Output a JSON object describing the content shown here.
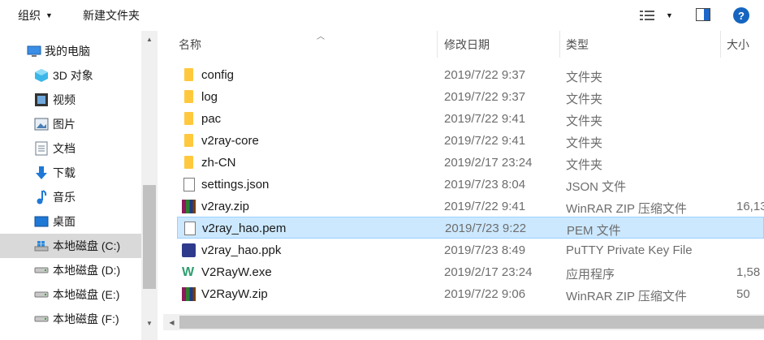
{
  "toolbar": {
    "organize_label": "组织",
    "new_folder_label": "新建文件夹",
    "help_label": "?"
  },
  "nav": {
    "items": [
      {
        "label": "我的电脑",
        "icon": "computer-icon"
      },
      {
        "label": "3D 对象",
        "icon": "3d-objects-icon"
      },
      {
        "label": "视频",
        "icon": "video-icon"
      },
      {
        "label": "图片",
        "icon": "pictures-icon"
      },
      {
        "label": "文档",
        "icon": "documents-icon"
      },
      {
        "label": "下载",
        "icon": "download-icon"
      },
      {
        "label": "音乐",
        "icon": "music-icon"
      },
      {
        "label": "桌面",
        "icon": "desktop-icon"
      },
      {
        "label": "本地磁盘 (C:)",
        "icon": "windows-drive-icon",
        "selected": true
      },
      {
        "label": "本地磁盘 (D:)",
        "icon": "drive-icon"
      },
      {
        "label": "本地磁盘 (E:)",
        "icon": "drive-icon"
      },
      {
        "label": "本地磁盘 (F:)",
        "icon": "drive-icon"
      }
    ]
  },
  "columns": {
    "name": "名称",
    "date": "修改日期",
    "type": "类型",
    "size": "大小"
  },
  "files": [
    {
      "name": "config",
      "date": "2019/7/22 9:37",
      "type": "文件夹",
      "size": "",
      "icon": "folder-icon"
    },
    {
      "name": "log",
      "date": "2019/7/22 9:37",
      "type": "文件夹",
      "size": "",
      "icon": "folder-icon"
    },
    {
      "name": "pac",
      "date": "2019/7/22 9:41",
      "type": "文件夹",
      "size": "",
      "icon": "folder-icon"
    },
    {
      "name": "v2ray-core",
      "date": "2019/7/22 9:41",
      "type": "文件夹",
      "size": "",
      "icon": "folder-icon"
    },
    {
      "name": "zh-CN",
      "date": "2019/2/17 23:24",
      "type": "文件夹",
      "size": "",
      "icon": "folder-icon"
    },
    {
      "name": "settings.json",
      "date": "2019/7/23 8:04",
      "type": "JSON 文件",
      "size": "",
      "icon": "file-icon"
    },
    {
      "name": "v2ray.zip",
      "date": "2019/7/22 9:41",
      "type": "WinRAR ZIP 压缩文件",
      "size": "16,13",
      "icon": "winrar-icon"
    },
    {
      "name": "v2ray_hao.pem",
      "date": "2019/7/23 9:22",
      "type": "PEM 文件",
      "size": "",
      "icon": "file-icon",
      "selected": true
    },
    {
      "name": "v2ray_hao.ppk",
      "date": "2019/7/23 8:49",
      "type": "PuTTY Private Key File",
      "size": "",
      "icon": "putty-key-icon"
    },
    {
      "name": "V2RayW.exe",
      "date": "2019/2/17 23:24",
      "type": "应用程序",
      "size": "1,58",
      "icon": "v2rayw-app-icon"
    },
    {
      "name": "V2RayW.zip",
      "date": "2019/7/22 9:06",
      "type": "WinRAR ZIP 压缩文件",
      "size": "50",
      "icon": "winrar-icon"
    }
  ]
}
